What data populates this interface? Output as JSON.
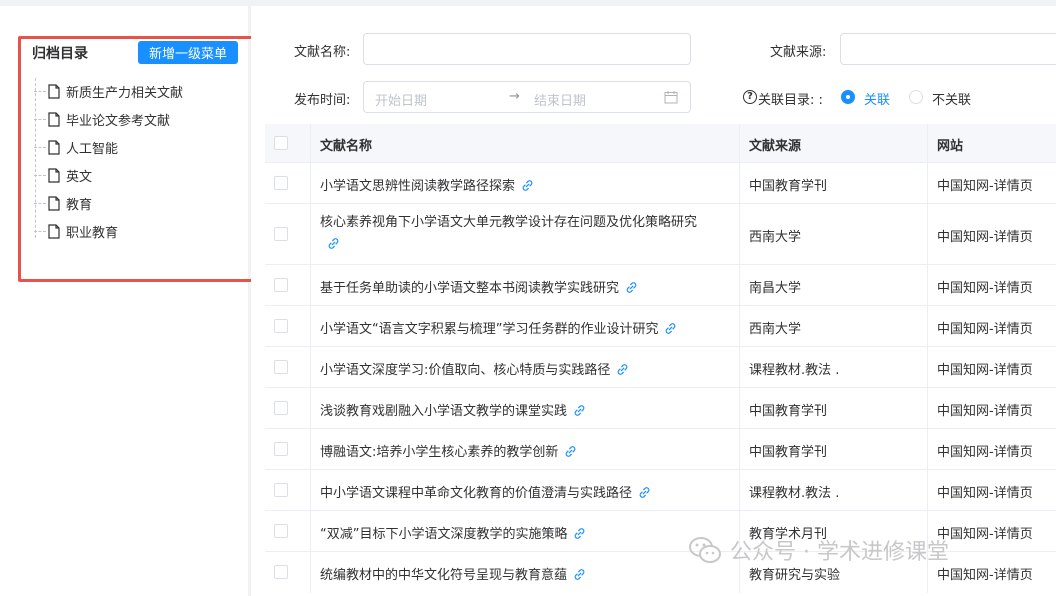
{
  "sidebar": {
    "title": "归档目录",
    "add_button": "新增一级菜单",
    "items": [
      {
        "label": "新质生产力相关文献"
      },
      {
        "label": "毕业论文参考文献"
      },
      {
        "label": "人工智能"
      },
      {
        "label": "英文"
      },
      {
        "label": "教育"
      },
      {
        "label": "职业教育"
      }
    ]
  },
  "filters": {
    "doc_name_label": "文献名称:",
    "doc_name_value": "",
    "doc_source_label": "文献来源:",
    "doc_source_value": "",
    "publish_time_label": "发布时间:",
    "start_date_placeholder": "开始日期",
    "range_separator": "→",
    "end_date_placeholder": "结束日期",
    "catalog_label": "关联目录: :",
    "radio_linked": "关联",
    "radio_unlinked": "不关联",
    "selected": "关联"
  },
  "table": {
    "headers": {
      "name": "文献名称",
      "source": "文献来源",
      "site": "网站"
    },
    "rows": [
      {
        "name": "小学语文思辨性阅读教学路径探索",
        "source": "中国教育学刊",
        "site": "中国知网-详情页"
      },
      {
        "name": "核心素养视角下小学语文大单元教学设计存在问题及优化策略研究",
        "source": "西南大学",
        "site": "中国知网-详情页"
      },
      {
        "name": "基于任务单助读的小学语文整本书阅读教学实践研究",
        "source": "南昌大学",
        "site": "中国知网-详情页"
      },
      {
        "name": "小学语文“语言文字积累与梳理”学习任务群的作业设计研究",
        "source": "西南大学",
        "site": "中国知网-详情页"
      },
      {
        "name": "小学语文深度学习:价值取向、核心特质与实践路径",
        "source": "课程教材.教法 .",
        "site": "中国知网-详情页"
      },
      {
        "name": "浅谈教育戏剧融入小学语文教学的课堂实践",
        "source": "中国教育学刊",
        "site": "中国知网-详情页"
      },
      {
        "name": "博融语文:培养小学生核心素养的教学创新",
        "source": "中国教育学刊",
        "site": "中国知网-详情页"
      },
      {
        "name": "中小学语文课程中革命文化教育的价值澄清与实践路径",
        "source": "课程教材.教法 .",
        "site": "中国知网-详情页"
      },
      {
        "name": "“双减”目标下小学语文深度教学的实施策略",
        "source": "教育学术月刊",
        "site": "中国知网-详情页"
      },
      {
        "name": "统编教材中的中华文化符号呈现与教育意蕴",
        "source": "教育研究与实验",
        "site": "中国知网-详情页"
      }
    ]
  },
  "watermark": {
    "text": "公众号 · 学术进修课堂"
  },
  "colors": {
    "primary": "#1890ff",
    "highlight_border": "#e5534b",
    "link": "#1890ff"
  }
}
